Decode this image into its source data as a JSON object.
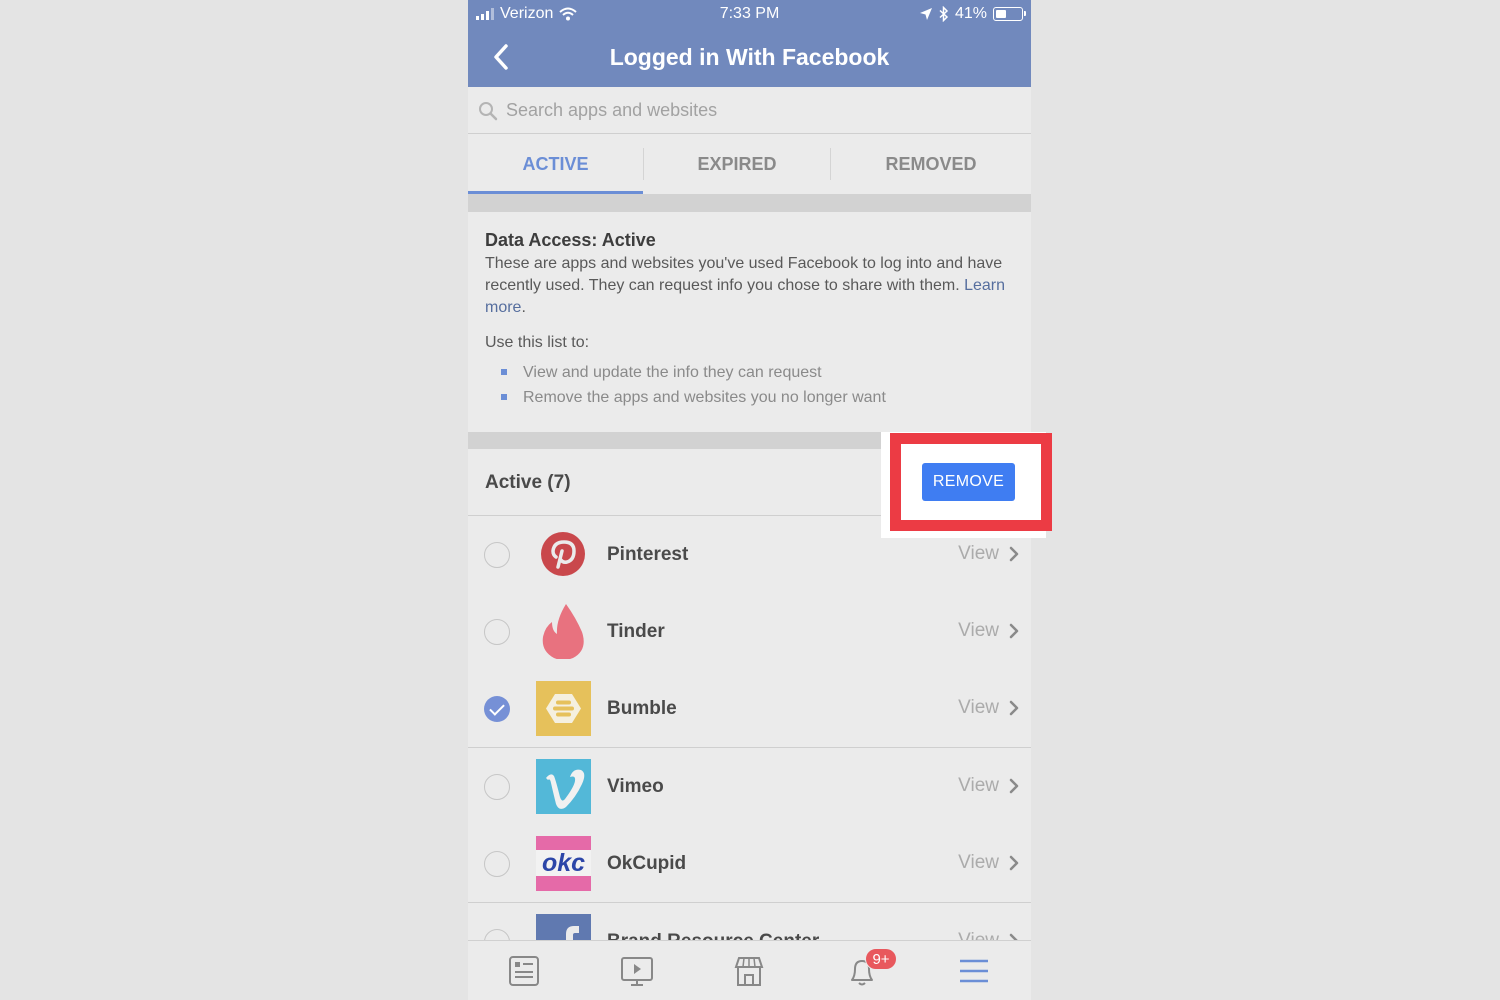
{
  "status_bar": {
    "carrier": "Verizon",
    "time": "7:33 PM",
    "battery": "41%"
  },
  "nav": {
    "title": "Logged in With Facebook"
  },
  "search": {
    "placeholder": "Search apps and websites"
  },
  "tabs": [
    {
      "label": "ACTIVE",
      "active": true
    },
    {
      "label": "EXPIRED",
      "active": false
    },
    {
      "label": "REMOVED",
      "active": false
    }
  ],
  "info": {
    "title": "Data Access: Active",
    "description": "These are apps and websites you've used Facebook to log into and have recently used. They can request info you chose to share with them. ",
    "learn_more": "Learn more",
    "period": ".",
    "use_list_label": "Use this list to:",
    "bullets": [
      "View and update the info they can request",
      "Remove the apps and websites you no longer want"
    ]
  },
  "active_section": {
    "header": "Active (7)",
    "remove_label": "REMOVE"
  },
  "apps": [
    {
      "name": "Pinterest",
      "view": "View",
      "checked": false,
      "icon": "pinterest-logo"
    },
    {
      "name": "Tinder",
      "view": "View",
      "checked": false,
      "icon": "tinder-logo"
    },
    {
      "name": "Bumble",
      "view": "View",
      "checked": true,
      "icon": "bumble-logo"
    },
    {
      "name": "Vimeo",
      "view": "View",
      "checked": false,
      "icon": "vimeo-logo"
    },
    {
      "name": "OkCupid",
      "view": "View",
      "checked": false,
      "icon": "okcupid-logo",
      "logo_text": "okc"
    },
    {
      "name": "Brand Resource Center",
      "view": "View",
      "checked": false,
      "icon": "facebook-logo"
    }
  ],
  "tab_bar": {
    "items": [
      "news-feed-icon",
      "watch-icon",
      "marketplace-icon",
      "notifications-icon",
      "menu-icon"
    ],
    "notification_badge": "9+"
  },
  "colors": {
    "header": "#7189bd",
    "accent": "#6b8ed6",
    "remove_button": "#3f7df2",
    "highlight": "#ec3b44"
  }
}
